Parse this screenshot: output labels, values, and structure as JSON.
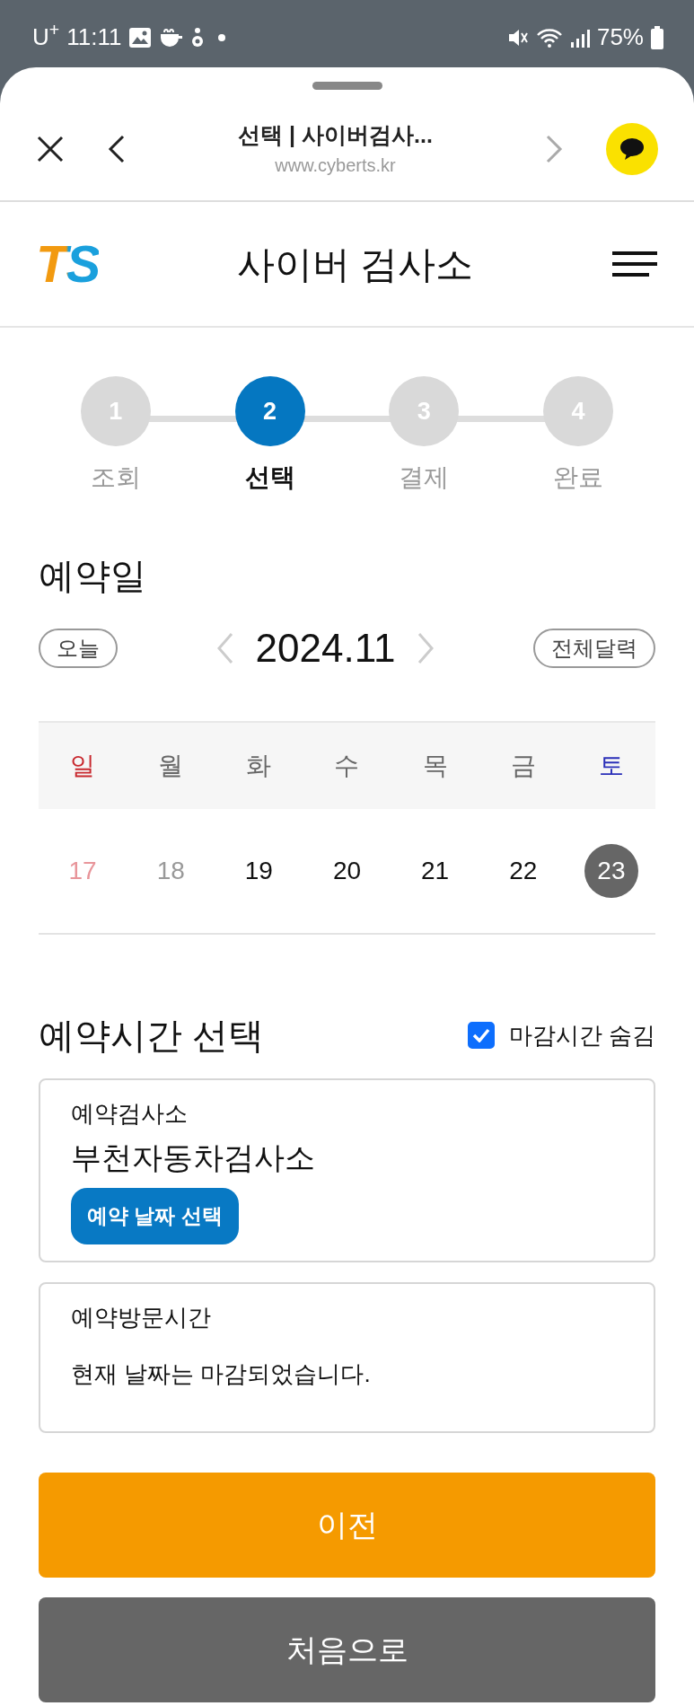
{
  "status_bar": {
    "carrier": "U$^{+}$",
    "time": "11:11",
    "battery": "75%"
  },
  "browser": {
    "title": "선택 | 사이버검사...",
    "url": "www.cyberts.kr"
  },
  "site_header": {
    "logo": "TS",
    "title": "사이버 검사소"
  },
  "stepper": [
    {
      "number": "1",
      "label": "조회",
      "selected": false
    },
    {
      "number": "2",
      "label": "선택",
      "selected": true
    },
    {
      "number": "3",
      "label": "결제",
      "selected": false
    },
    {
      "number": "4",
      "label": "완료",
      "selected": false
    }
  ],
  "reservation_date": {
    "heading": "예약일",
    "today_button": "오늘",
    "month": "2024.11",
    "full_calendar_button": "전체달력",
    "weekdays": [
      {
        "label": "일",
        "kind": "sunday"
      },
      {
        "label": "월",
        "kind": "weekday"
      },
      {
        "label": "화",
        "kind": "weekday"
      },
      {
        "label": "수",
        "kind": "weekday"
      },
      {
        "label": "목",
        "kind": "weekday"
      },
      {
        "label": "금",
        "kind": "weekday"
      },
      {
        "label": "토",
        "kind": "saturday"
      }
    ],
    "dates": [
      {
        "label": "17",
        "kind": "sunday",
        "disabled": true,
        "selected": false
      },
      {
        "label": "18",
        "kind": "weekday",
        "disabled": true,
        "selected": false
      },
      {
        "label": "19",
        "kind": "weekday",
        "disabled": false,
        "selected": false
      },
      {
        "label": "20",
        "kind": "weekday",
        "disabled": false,
        "selected": false
      },
      {
        "label": "21",
        "kind": "weekday",
        "disabled": false,
        "selected": false
      },
      {
        "label": "22",
        "kind": "weekday",
        "disabled": false,
        "selected": false
      },
      {
        "label": "23",
        "disabled": false,
        "selected": true
      }
    ]
  },
  "time_section": {
    "heading": "예약시간 선택",
    "hide_closed": {
      "label": "마감시간 숨김",
      "checked": true
    },
    "station_card": {
      "label": "예약검사소",
      "value": "부천자동차검사소",
      "button": "예약 날짜 선택"
    },
    "visit_card": {
      "label": "예약방문시간",
      "message": "현재 날짜는 마감되었습니다."
    }
  },
  "buttons": [
    {
      "label": "이전",
      "kind": "prev"
    },
    {
      "label": "처음으로",
      "kind": "home"
    }
  ]
}
